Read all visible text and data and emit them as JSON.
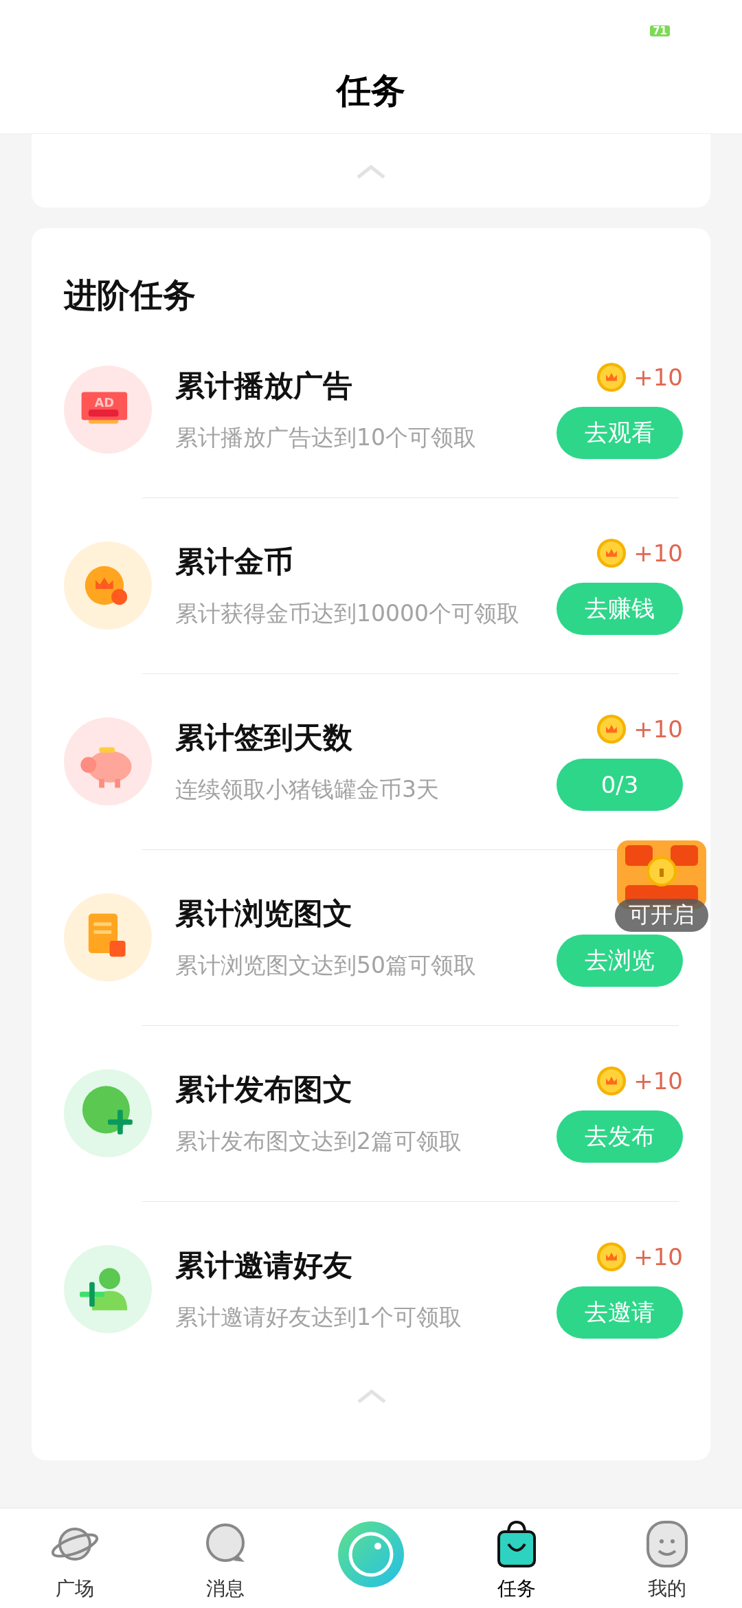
{
  "status_bar": {
    "battery": "71"
  },
  "header": {
    "title": "任务"
  },
  "section": {
    "title": "进阶任务",
    "tasks": [
      {
        "title": "累计播放广告",
        "icon_text": "AD",
        "description": "累计播放广告达到10个可领取",
        "reward": "+10",
        "action": "去观看"
      },
      {
        "title": "累计金币",
        "description": "累计获得金币达到10000个可领取",
        "reward": "+10",
        "action": "去赚钱"
      },
      {
        "title": "累计签到天数",
        "description": "连续领取小猪钱罐金币3天",
        "reward": "+10",
        "action": "0/3"
      },
      {
        "title": "累计浏览图文",
        "description": "累计浏览图文达到50篇可领取",
        "action": "去浏览"
      },
      {
        "title": "累计发布图文",
        "description": "累计发布图文达到2篇可领取",
        "reward": "+10",
        "action": "去发布"
      },
      {
        "title": "累计邀请好友",
        "description": "累计邀请好友达到1个可领取",
        "reward": "+10",
        "action": "去邀请"
      }
    ]
  },
  "floating_chest": {
    "label": "可开启"
  },
  "bottom_nav": [
    {
      "kind": "tab",
      "label": "广场",
      "selected": false
    },
    {
      "kind": "tab",
      "label": "消息",
      "selected": false
    },
    {
      "kind": "camera"
    },
    {
      "kind": "tab",
      "label": "任务",
      "selected": true
    },
    {
      "kind": "tab",
      "label": "我的",
      "selected": false
    }
  ]
}
